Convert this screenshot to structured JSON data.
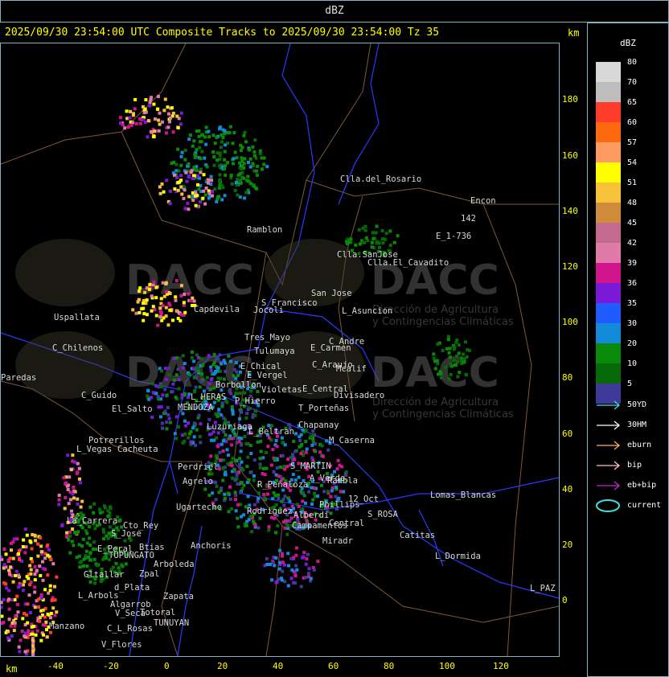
{
  "window": {
    "title": "dBZ"
  },
  "header": {
    "text": "2025/09/30 23:54:00 UTC Composite Tracks to 2025/09/30 23:54:00 Tz 35",
    "km_label": "km"
  },
  "axes": {
    "y_ticks": [
      "180",
      "160",
      "140",
      "120",
      "100",
      "80",
      "60",
      "40",
      "20",
      "0"
    ],
    "x_ticks": [
      "-40",
      "-20",
      "0",
      "20",
      "40",
      "60",
      "80",
      "100",
      "120"
    ],
    "unit": "km"
  },
  "legend": {
    "title": "dBZ",
    "levels": [
      {
        "label": "80",
        "color": "#d8d8d8"
      },
      {
        "label": "70",
        "color": "#bdbdbd"
      },
      {
        "label": "65",
        "color": "#ff3b2a"
      },
      {
        "label": "60",
        "color": "#ff6a10"
      },
      {
        "label": "57",
        "color": "#ff9a60"
      },
      {
        "label": "54",
        "color": "#ffff00"
      },
      {
        "label": "51",
        "color": "#f8c13a"
      },
      {
        "label": "48",
        "color": "#cf8a3a"
      },
      {
        "label": "45",
        "color": "#c46a8e"
      },
      {
        "label": "42",
        "color": "#e07aa8"
      },
      {
        "label": "39",
        "color": "#d0148c"
      },
      {
        "label": "36",
        "color": "#7a1ad6"
      },
      {
        "label": "35",
        "color": "#1e5cff"
      },
      {
        "label": "30",
        "color": "#138ad8"
      },
      {
        "label": "20",
        "color": "#0a8a0a"
      },
      {
        "label": "10",
        "color": "#066a06"
      },
      {
        "label": "5",
        "color": "#3f3a9a"
      }
    ],
    "tracks": [
      {
        "label": "50YD",
        "color": "#40e0e0"
      },
      {
        "label": "30HM",
        "color": "#ffffff"
      },
      {
        "label": "eburn",
        "color": "#ffb060"
      },
      {
        "label": "bip",
        "color": "#ffc0c0"
      },
      {
        "label": "eb+bip",
        "color": "#d020d0"
      },
      {
        "label": "current",
        "color": "#40e0e0"
      }
    ]
  },
  "watermark": {
    "brand": "DACC",
    "line1": "Dirección de Agricultura",
    "line2": "y Contingencias Climáticas"
  },
  "places": [
    "Clla.del_Rosario",
    "Encon",
    "Ramblon",
    "E_1-736",
    "142",
    "Clla.SanJose",
    "Clla.El_Cavadito",
    "San Jose",
    "S_Francisco",
    "L_Asuncion",
    "Uspallata",
    "Capdevila",
    "Jocoli",
    "Tres_Mayo",
    "Tulumaya",
    "C_Andre",
    "E_Carmen",
    "C_Chilenos",
    "C_Araujo",
    "Mcalif",
    "E_Chical",
    "E_Vergel",
    "Borbollon",
    "Violetas",
    "E_Central",
    "Divisadero",
    "Paredas",
    "C_Guido",
    "P_Hierro",
    "L_HERAS",
    "T_Porteñas",
    "El_Salto",
    "MENDOZA",
    "L_Beltran",
    "Luzuriaga",
    "Chapanay",
    "Potrerillos",
    "Cacheuta",
    "L_Vegas",
    "Perdriel",
    "Agrelo",
    "M_Caserna",
    "S_MARTIN",
    "A_Verde",
    "Rambla",
    "R_Peñaloza",
    "Lomas_Blancas",
    "12_Oct",
    "Ugarteche",
    "Phillips",
    "Rodriguez",
    "Alberdi",
    "S_ROSA",
    "Campamentos",
    "Central",
    "La_Carrera",
    "Cto_Rey",
    "S_Jose",
    "Catitas",
    "Anchoris",
    "E_Peral",
    "Btias",
    "TUPUNGATO",
    "Miradr",
    "L_Dormida",
    "Arboleda",
    "Gltallar",
    "Zpal",
    "d_Plata",
    "L_Arbols",
    "L_PAZ",
    "Zapata",
    "Algarrob",
    "V_Seca",
    "Totoral",
    "TUNUYAN",
    "Manzano",
    "C_L_Rosas",
    "V_Flores"
  ]
}
